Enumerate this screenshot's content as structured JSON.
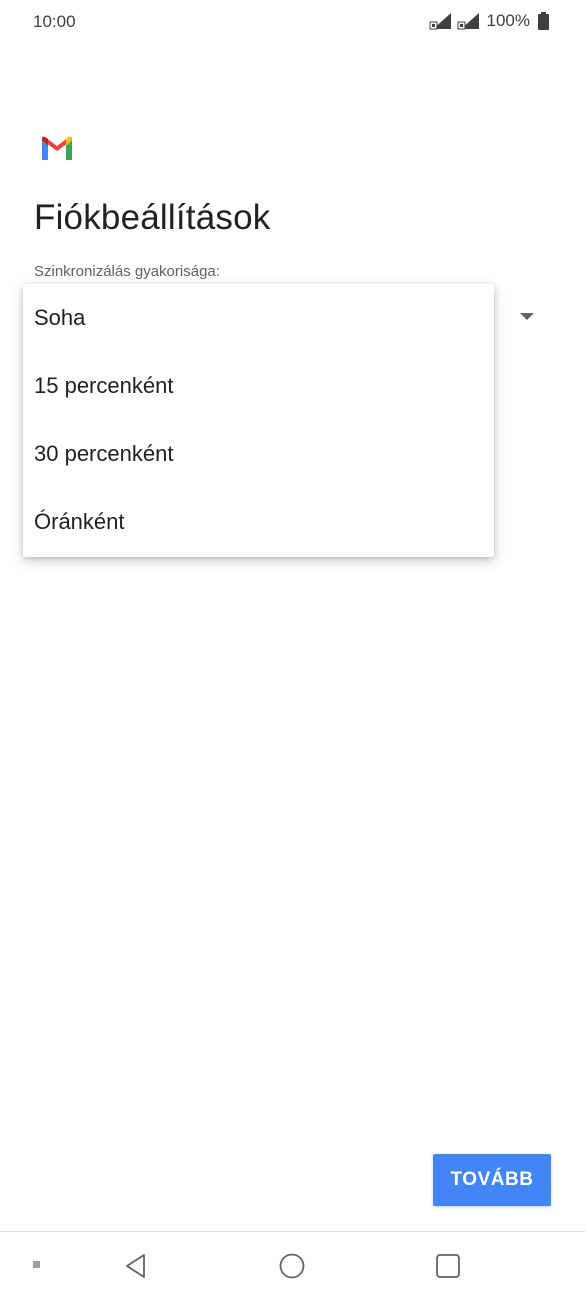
{
  "status_bar": {
    "time": "10:00",
    "battery_percent": "100%"
  },
  "header": {
    "logo_icon": "gmail-m-icon",
    "title": "Fiókbeállítások"
  },
  "sync_field": {
    "label": "Szinkronizálás gyakorisága:",
    "options": [
      "Soha",
      "15 percenként",
      "30 percenként",
      "Óránként"
    ]
  },
  "actions": {
    "next_label": "TOVÁBB"
  },
  "colors": {
    "primary_button": "#4285f4",
    "gmail_red": "#ea4335",
    "gmail_blue": "#4285f4",
    "gmail_green": "#34a853",
    "gmail_yellow": "#fbbc04"
  },
  "nav_bar": {
    "icons": [
      "dot-icon",
      "back-icon",
      "home-icon",
      "recent-apps-icon"
    ]
  }
}
